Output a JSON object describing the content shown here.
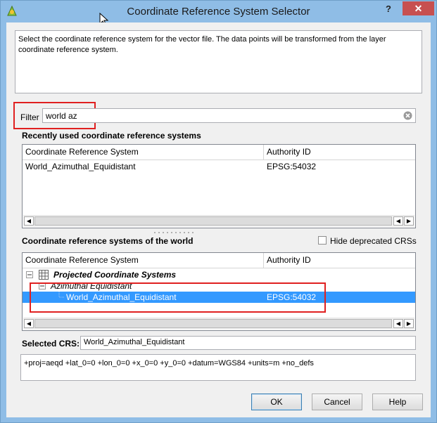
{
  "window": {
    "title": "Coordinate Reference System Selector",
    "help_label": "?",
    "close_label": "✕"
  },
  "description": "Select the coordinate reference system for the vector file. The data points will be transformed from the layer coordinate reference system.",
  "filter": {
    "label": "Filter",
    "value": "world az"
  },
  "recent": {
    "title": "Recently used coordinate reference systems",
    "columns": [
      "Coordinate Reference System",
      "Authority ID"
    ],
    "rows": [
      {
        "crs": "World_Azimuthal_Equidistant",
        "auth": "EPSG:54032"
      }
    ]
  },
  "world": {
    "title": "Coordinate reference systems of the world",
    "hide_deprecated_label": "Hide deprecated CRSs",
    "hide_deprecated_checked": false,
    "columns": [
      "Coordinate Reference System",
      "Authority ID"
    ],
    "tree": {
      "group": "Projected Coordinate Systems",
      "subgroup": "Azimuthal Equidistant",
      "item": {
        "crs": "World_Azimuthal_Equidistant",
        "auth": "EPSG:54032"
      }
    }
  },
  "selected": {
    "label": "Selected CRS:",
    "value": "World_Azimuthal_Equidistant",
    "proj4": "+proj=aeqd +lat_0=0 +lon_0=0 +x_0=0 +y_0=0 +datum=WGS84 +units=m +no_defs"
  },
  "buttons": {
    "ok": "OK",
    "cancel": "Cancel",
    "help": "Help"
  },
  "colors": {
    "title_bar": "#8fbde6",
    "selection": "#3399ff",
    "highlight": "#e02020"
  }
}
